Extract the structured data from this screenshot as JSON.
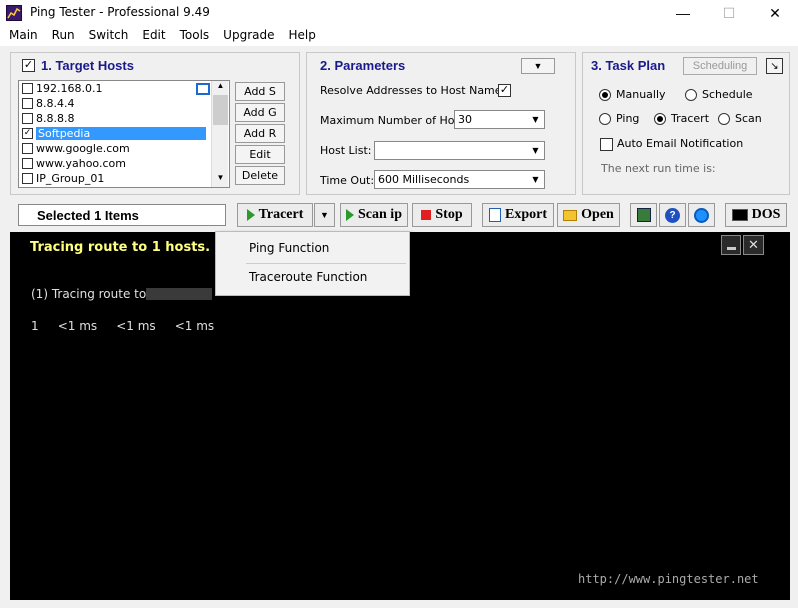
{
  "window": {
    "title": "Ping Tester - Professional  9.49"
  },
  "menu": [
    "Main",
    "Run",
    "Switch",
    "Edit",
    "Tools",
    "Upgrade",
    "Help"
  ],
  "hosts_panel": {
    "title": "1. Target Hosts",
    "title_checked": true,
    "hosts": [
      {
        "name": "192.168.0.1",
        "checked": false,
        "selected": false
      },
      {
        "name": "8.8.4.4",
        "checked": false,
        "selected": false
      },
      {
        "name": "8.8.8.8",
        "checked": false,
        "selected": false
      },
      {
        "name": "Softpedia",
        "checked": true,
        "selected": true
      },
      {
        "name": "www.google.com",
        "checked": false,
        "selected": false
      },
      {
        "name": "www.yahoo.com",
        "checked": false,
        "selected": false
      },
      {
        "name": "IP_Group_01",
        "checked": false,
        "selected": false
      }
    ],
    "buttons": [
      "Add S",
      "Add G",
      "Add R",
      "Edit",
      "Delete"
    ]
  },
  "params_panel": {
    "title": "2. Parameters",
    "resolve_label": "Resolve Addresses to Host Names:",
    "resolve_checked": true,
    "hops_label": "Maximum Number of Hops:",
    "hops_value": "30",
    "hostlist_label": "Host List:",
    "hostlist_value": "",
    "timeout_label": "Time Out:",
    "timeout_value": "600  Milliseconds"
  },
  "task_panel": {
    "title": "3. Task Plan",
    "scheduling_label": "Scheduling",
    "manually": "Manually",
    "schedule": "Schedule",
    "ping": "Ping",
    "tracert": "Tracert",
    "scan": "Scan",
    "email": "Auto Email Notification",
    "next_run": "The next run time is:"
  },
  "toolbar": {
    "selected": "Selected 1 Items",
    "tracert": "Tracert",
    "scanip": "Scan ip",
    "stop": "Stop",
    "export": "Export",
    "open": "Open",
    "dos": "DOS"
  },
  "console": {
    "heading": "Tracing route to 1 hosts.",
    "line1": "(1) Tracing route to",
    "result": "1     <1 ms     <1 ms     <1 ms",
    "url": "http://www.pingtester.net"
  },
  "dropdown": [
    "Ping Function",
    "Traceroute Function"
  ],
  "colors": {
    "accent": "#1a1a8c",
    "selection": "#3399ff",
    "console_bg": "#000000",
    "heading": "#ffff80"
  }
}
